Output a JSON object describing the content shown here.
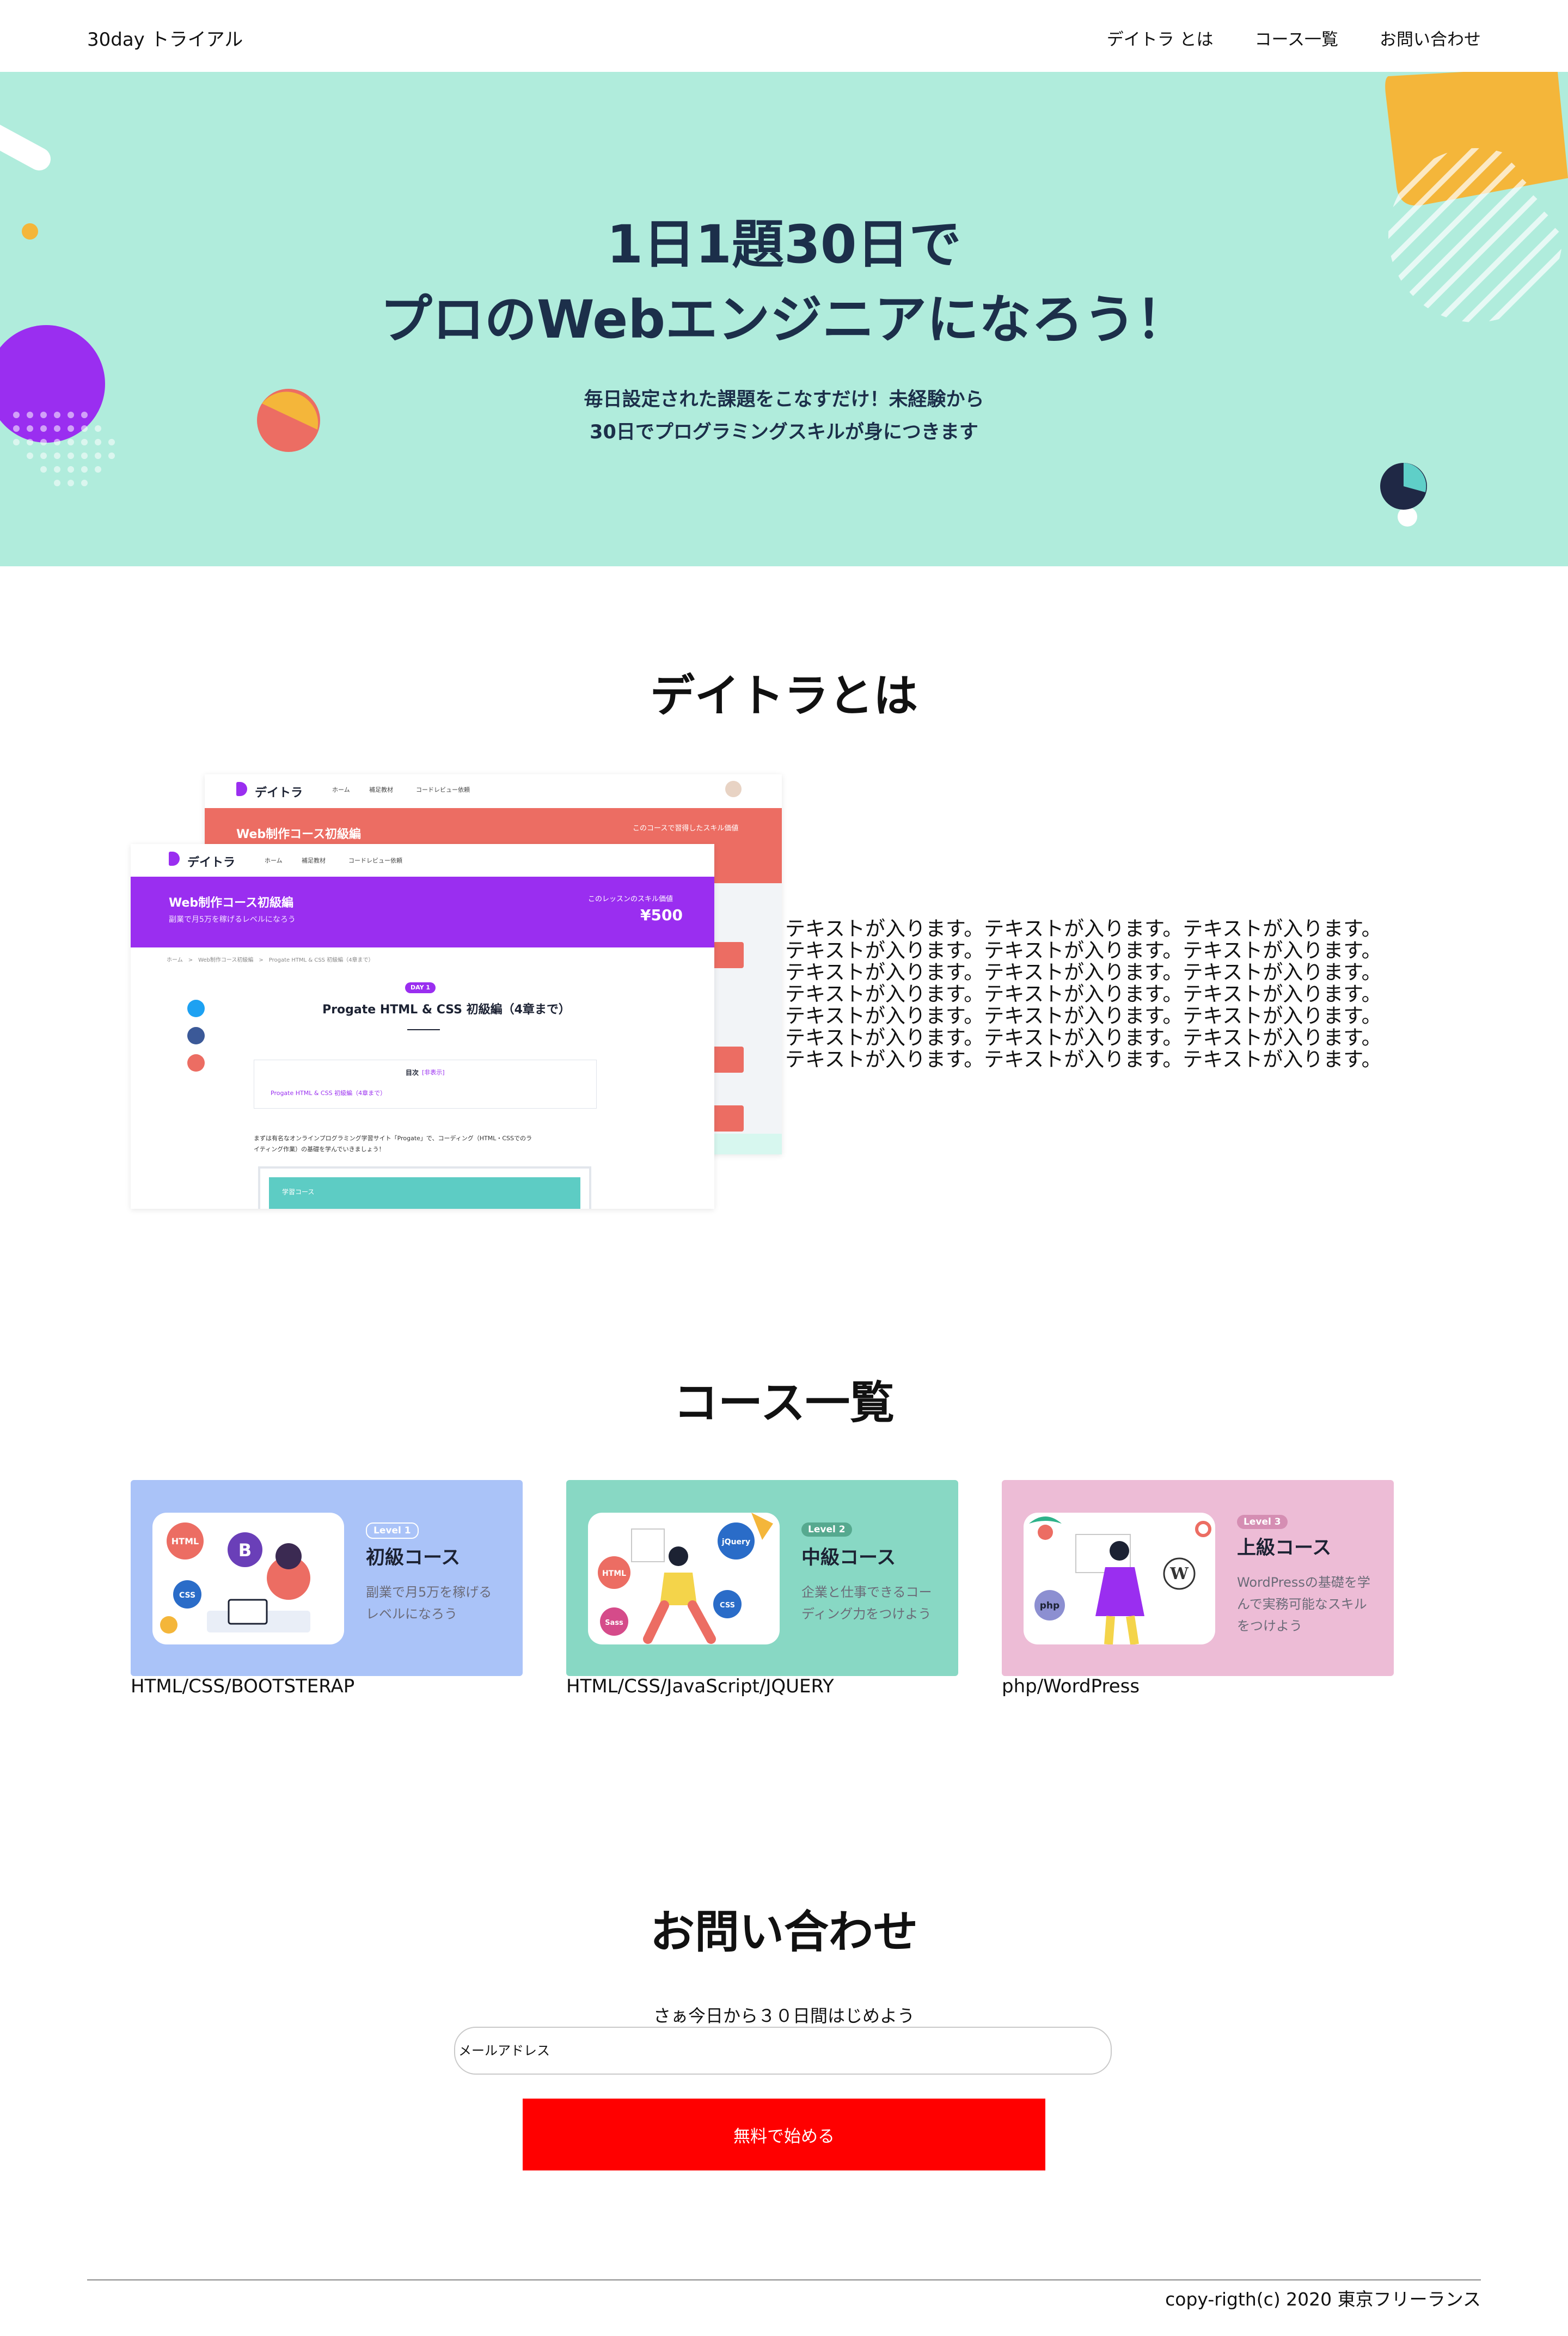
{
  "header": {
    "logo": "30day トライアル",
    "nav": [
      "デイトラ とは",
      "コース一覧",
      "お問い合わせ"
    ]
  },
  "hero": {
    "title_lines": [
      "1日1題30日で",
      "プロのWebエンジニアになろう！"
    ],
    "subtitle_lines": [
      "毎日設定された課題をこなすだけ！未経験から",
      "30日でプログラミングスキルが身につきます"
    ]
  },
  "about": {
    "title": "デイトラとは",
    "screenshot_back": {
      "brand": "デイトラ",
      "nav": [
        "ホーム",
        "補足教材",
        "コードレビュー依頼"
      ],
      "banner_title": "Web制作コース初級編",
      "banner_right": "このコースで習得したスキル価値"
    },
    "screenshot_front": {
      "brand": "デイトラ",
      "nav": [
        "ホーム",
        "補足教材",
        "コードレビュー依頼"
      ],
      "banner_title": "Web制作コース初級編",
      "banner_sub": "副業で月5万を稼げるレベルになろう",
      "skill_value_label": "このレッスンのスキル価値",
      "skill_value": "¥500",
      "breadcrumb": "ホーム　>　Web制作コース初級編　>　Progate HTML & CSS 初級編（4章まで）",
      "day_badge": "DAY 1",
      "lesson_title": "Progate HTML & CSS 初級編（4章まで）",
      "toc_label": "目次",
      "toc_toggle": "[非表示]",
      "toc_item": "Progate HTML & CSS 初級編（4章まで）",
      "intro_line1": "まずは有名なオンラインプログラミング学習サイト「Progate」で、コーディング（HTML・CSSでのラ",
      "intro_line2": "イティング作業）の基礎を学んでいきましょう！",
      "card_label": "学習コース"
    },
    "text_lines": [
      "テキストが入ります。テキストが入ります。テキストが入ります。",
      "テキストが入ります。テキストが入ります。テキストが入ります。",
      "テキストが入ります。テキストが入ります。テキストが入ります。",
      "テキストが入ります。テキストが入ります。テキストが入ります。",
      "テキストが入ります。テキストが入ります。テキストが入ります。",
      "テキストが入ります。テキストが入ります。テキストが入ります。",
      "テキストが入ります。テキストが入ります。テキストが入ります。"
    ]
  },
  "courses": {
    "title": "コース一覧",
    "items": [
      {
        "level": "Level 1",
        "name": "初級コース",
        "desc": "副業で月5万を稼げるレベルになろう",
        "tags": "HTML/CSS/BOOTSTERAP",
        "bg": "#aac3f8",
        "level_color": "#aac3f8",
        "icons": [
          "HTML",
          "B",
          "CSS"
        ]
      },
      {
        "level": "Level 2",
        "name": "中級コース",
        "desc": "企業と仕事できるコーディング力をつけよう",
        "tags": "HTML/CSS/JavaScript/JQUERY",
        "bg": "#88d8c4",
        "level_color": "#56a98f",
        "icons": [
          "HTML",
          "jQuery",
          "CSS",
          "Sass"
        ]
      },
      {
        "level": "Level 3",
        "name": "上級コース",
        "desc": "WordPressの基礎を学んで実務可能なスキルをつけよう",
        "tags": "php/WordPress",
        "bg": "#edbcd6",
        "level_color": "#d58eb3",
        "icons": [
          "php",
          "W"
        ]
      }
    ]
  },
  "contact": {
    "title": "お問い合わせ",
    "lead": "さぁ今日から３０日間はじめよう",
    "email_placeholder": "メールアドレス",
    "submit_label": "無料で始める"
  },
  "footer": {
    "copyright": "copy-rigth(c) 2020 東京フリーランス"
  },
  "colors": {
    "hero_bg": "#b0ecdc",
    "hero_text": "#1c2f4a",
    "cta": "#ff0000",
    "purple": "#9a2ef0",
    "coral": "#ec6d63"
  }
}
